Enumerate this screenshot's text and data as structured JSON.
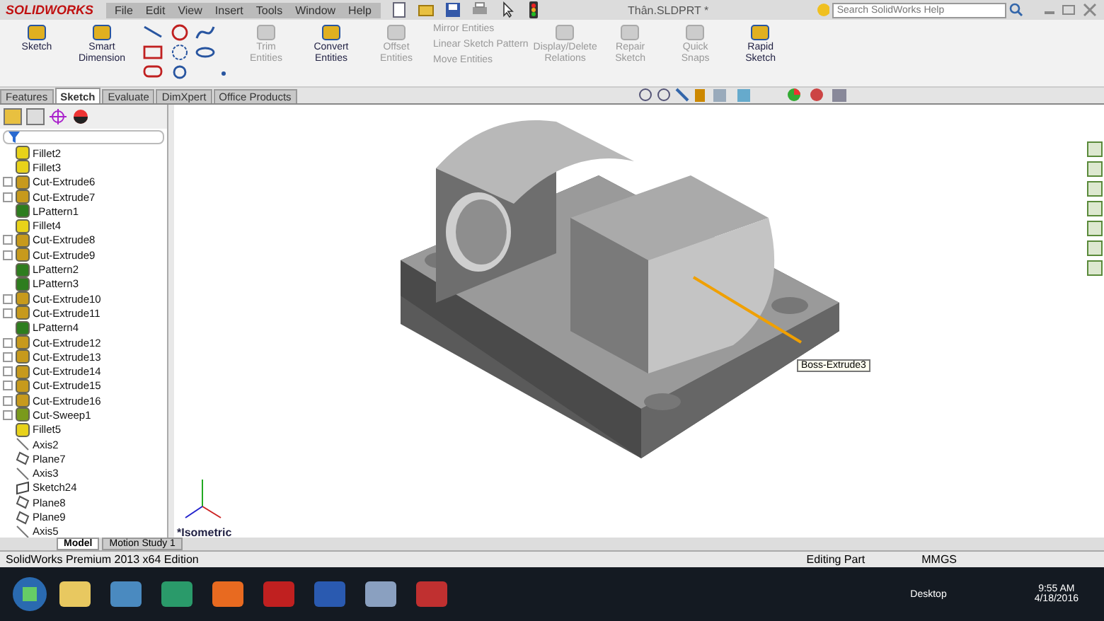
{
  "app": {
    "logo": "SOLIDWORKS",
    "menu": [
      "File",
      "Edit",
      "View",
      "Insert",
      "Tools",
      "Window",
      "Help"
    ],
    "document_title": "Thân.SLDPRT *",
    "search": {
      "placeholder": "Search SolidWorks Help"
    }
  },
  "command_manager": {
    "tools": [
      {
        "label": "Sketch",
        "kind": "large",
        "disabled": false
      },
      {
        "label": "Smart Dimension",
        "kind": "large",
        "disabled": false
      },
      {
        "kind": "grid"
      },
      {
        "label": "Trim Entities",
        "kind": "large",
        "disabled": true
      },
      {
        "label": "Convert Entities",
        "kind": "large",
        "disabled": false
      },
      {
        "label": "Offset Entities",
        "kind": "large",
        "disabled": true
      },
      {
        "kind": "stack",
        "disabled": true
      },
      {
        "label": "Display/Delete Relations",
        "kind": "large",
        "disabled": true
      },
      {
        "label": "Repair Sketch",
        "kind": "large",
        "disabled": true
      },
      {
        "label": "Quick Snaps",
        "kind": "large",
        "disabled": true
      },
      {
        "label": "Rapid Sketch",
        "kind": "large",
        "disabled": false
      }
    ],
    "stack_items": [
      "Mirror Entities",
      "Linear Sketch Pattern",
      "Move Entities"
    ]
  },
  "tabs": [
    {
      "label": "Features",
      "selected": false
    },
    {
      "label": "Sketch",
      "selected": true
    },
    {
      "label": "Evaluate",
      "selected": false
    },
    {
      "label": "DimXpert",
      "selected": false
    },
    {
      "label": "Office Products",
      "selected": false
    }
  ],
  "feature_tree": {
    "items": [
      {
        "label": "Fillet2",
        "kind": "fillet",
        "expandable": false
      },
      {
        "label": "Fillet3",
        "kind": "fillet",
        "expandable": false
      },
      {
        "label": "Cut-Extrude6",
        "kind": "cut",
        "expandable": true
      },
      {
        "label": "Cut-Extrude7",
        "kind": "cut",
        "expandable": true
      },
      {
        "label": "LPattern1",
        "kind": "pattern",
        "expandable": false
      },
      {
        "label": "Fillet4",
        "kind": "fillet",
        "expandable": false
      },
      {
        "label": "Cut-Extrude8",
        "kind": "cut",
        "expandable": true
      },
      {
        "label": "Cut-Extrude9",
        "kind": "cut",
        "expandable": true
      },
      {
        "label": "LPattern2",
        "kind": "pattern",
        "expandable": false
      },
      {
        "label": "LPattern3",
        "kind": "pattern",
        "expandable": false
      },
      {
        "label": "Cut-Extrude10",
        "kind": "cut",
        "expandable": true
      },
      {
        "label": "Cut-Extrude11",
        "kind": "cut",
        "expandable": true
      },
      {
        "label": "LPattern4",
        "kind": "pattern",
        "expandable": false
      },
      {
        "label": "Cut-Extrude12",
        "kind": "cut",
        "expandable": true
      },
      {
        "label": "Cut-Extrude13",
        "kind": "cut",
        "expandable": true
      },
      {
        "label": "Cut-Extrude14",
        "kind": "cut",
        "expandable": true
      },
      {
        "label": "Cut-Extrude15",
        "kind": "cut",
        "expandable": true
      },
      {
        "label": "Cut-Extrude16",
        "kind": "cut",
        "expandable": true
      },
      {
        "label": "Cut-Sweep1",
        "kind": "sweep",
        "expandable": true
      },
      {
        "label": "Fillet5",
        "kind": "fillet",
        "expandable": false
      },
      {
        "label": "Axis2",
        "kind": "axis",
        "expandable": false
      },
      {
        "label": "Plane7",
        "kind": "plane",
        "expandable": false
      },
      {
        "label": "Axis3",
        "kind": "axis",
        "expandable": false
      },
      {
        "label": "Sketch24",
        "kind": "sketch",
        "expandable": false
      },
      {
        "label": "Plane8",
        "kind": "plane",
        "expandable": false
      },
      {
        "label": "Plane9",
        "kind": "plane",
        "expandable": false
      },
      {
        "label": "Axis5",
        "kind": "axis",
        "expandable": false
      }
    ]
  },
  "viewport": {
    "tooltip": "Boss-Extrude3",
    "view_name": "*Isometric"
  },
  "bottom_tabs": [
    {
      "label": "Model",
      "selected": true
    },
    {
      "label": "Motion Study 1",
      "selected": false
    }
  ],
  "status_bar": {
    "edition": "SolidWorks Premium 2013 x64 Edition",
    "mode": "Editing Part",
    "units": "MMGS"
  },
  "taskbar": {
    "desktop": "Desktop",
    "time": "9:55 AM",
    "date": "4/18/2016"
  }
}
